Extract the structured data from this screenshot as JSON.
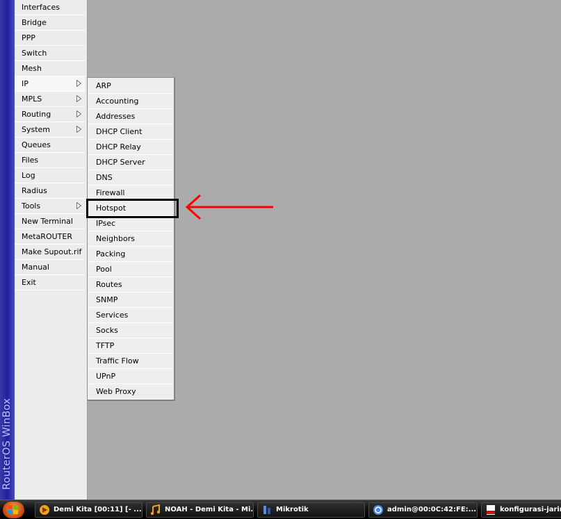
{
  "sidebar": {
    "brand": "RouterOS WinBox",
    "items": [
      {
        "label": "Interfaces",
        "has_submenu": false
      },
      {
        "label": "Bridge",
        "has_submenu": false
      },
      {
        "label": "PPP",
        "has_submenu": false
      },
      {
        "label": "Switch",
        "has_submenu": false
      },
      {
        "label": "Mesh",
        "has_submenu": false
      },
      {
        "label": "IP",
        "has_submenu": true,
        "active": true
      },
      {
        "label": "MPLS",
        "has_submenu": true
      },
      {
        "label": "Routing",
        "has_submenu": true
      },
      {
        "label": "System",
        "has_submenu": true
      },
      {
        "label": "Queues",
        "has_submenu": false
      },
      {
        "label": "Files",
        "has_submenu": false
      },
      {
        "label": "Log",
        "has_submenu": false
      },
      {
        "label": "Radius",
        "has_submenu": false
      },
      {
        "label": "Tools",
        "has_submenu": true
      },
      {
        "label": "New Terminal",
        "has_submenu": false
      },
      {
        "label": "MetaROUTER",
        "has_submenu": false
      },
      {
        "label": "Make Supout.rif",
        "has_submenu": false
      },
      {
        "label": "Manual",
        "has_submenu": false
      },
      {
        "label": "Exit",
        "has_submenu": false
      }
    ]
  },
  "ip_submenu": {
    "items": [
      "ARP",
      "Accounting",
      "Addresses",
      "DHCP Client",
      "DHCP Relay",
      "DHCP Server",
      "DNS",
      "Firewall",
      "Hotspot",
      "IPsec",
      "Neighbors",
      "Packing",
      "Pool",
      "Routes",
      "SNMP",
      "Services",
      "Socks",
      "TFTP",
      "Traffic Flow",
      "UPnP",
      "Web Proxy"
    ],
    "highlighted": "Hotspot"
  },
  "annotation": {
    "arrow_color": "#ff0000",
    "box_color": "#000000"
  },
  "taskbar": {
    "buttons": [
      {
        "label": "Demi Kita [00:11] [- ...",
        "icon": "media-player-icon"
      },
      {
        "label": "NOAH - Demi Kita - Mi...",
        "icon": "music-icon"
      },
      {
        "label": "Mikrotik",
        "icon": "mikrotik-icon"
      },
      {
        "label": "admin@00:0C:42:FE:...",
        "icon": "winbox-icon"
      },
      {
        "label": "konfigurasi-jaring",
        "icon": "pdf-icon"
      }
    ]
  },
  "colors": {
    "sidebar_brand": "#2a2aa8",
    "desktop": "#ababab",
    "menu_bg": "#ececec"
  }
}
